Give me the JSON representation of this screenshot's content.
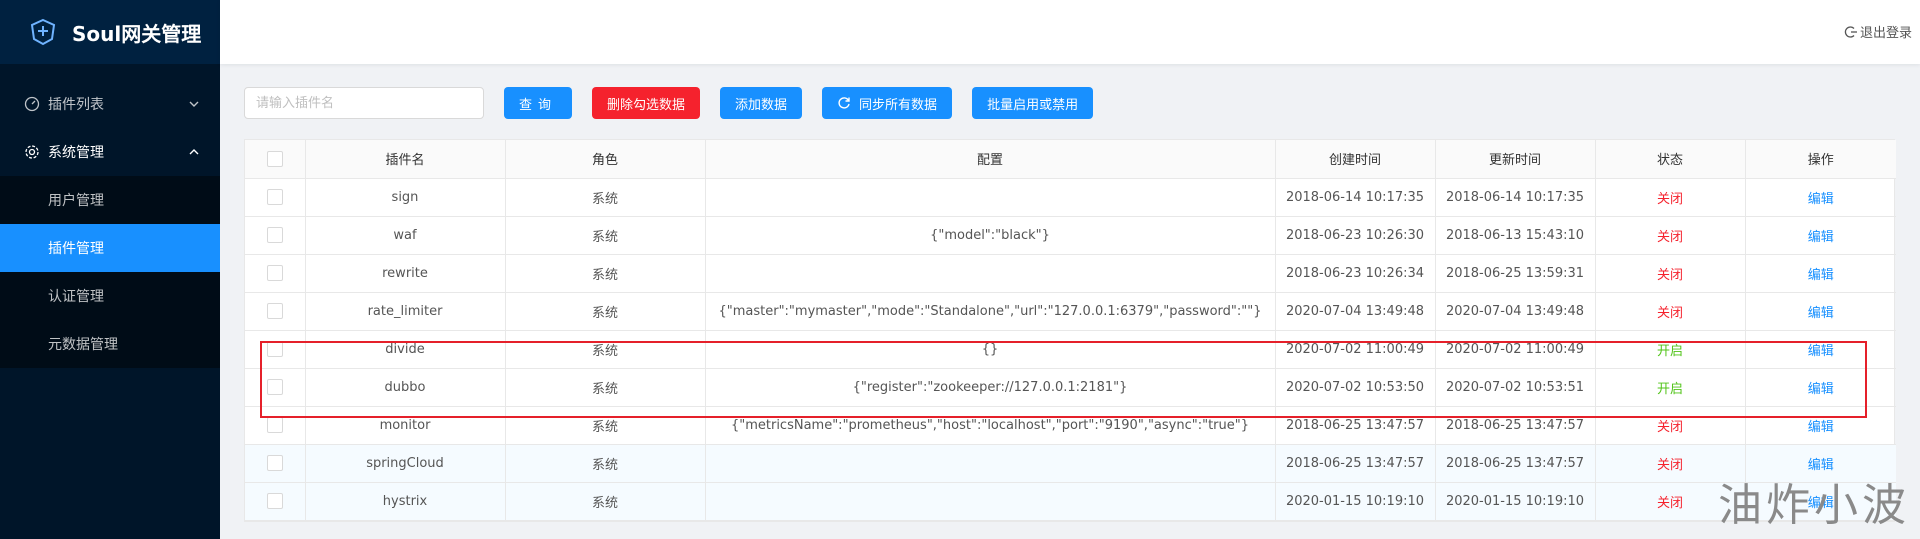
{
  "app": {
    "title": "Soul网关管理"
  },
  "header": {
    "logout_label": "退出登录"
  },
  "sidebar": {
    "items": [
      {
        "label": "插件列表",
        "icon": "dashboard-icon",
        "expanded": false
      },
      {
        "label": "系统管理",
        "icon": "gear-icon",
        "expanded": true,
        "children": [
          "用户管理",
          "插件管理",
          "认证管理",
          "元数据管理"
        ],
        "active_child": "插件管理"
      }
    ]
  },
  "toolbar": {
    "search_placeholder": "请输入插件名",
    "query_label": "查询",
    "delete_label": "删除勾选数据",
    "add_label": "添加数据",
    "sync_label": "同步所有数据",
    "batch_label": "批量启用或禁用"
  },
  "table": {
    "columns": [
      "插件名",
      "角色",
      "配置",
      "创建时间",
      "更新时间",
      "状态",
      "操作"
    ],
    "rows": [
      {
        "name": "sign",
        "role": "系统",
        "config": "",
        "created": "2018-06-14 10:17:35",
        "updated": "2018-06-14 10:17:35",
        "status": "关闭",
        "action": "编辑"
      },
      {
        "name": "waf",
        "role": "系统",
        "config": "{\"model\":\"black\"}",
        "created": "2018-06-23 10:26:30",
        "updated": "2018-06-13 15:43:10",
        "status": "关闭",
        "action": "编辑"
      },
      {
        "name": "rewrite",
        "role": "系统",
        "config": "",
        "created": "2018-06-23 10:26:34",
        "updated": "2018-06-25 13:59:31",
        "status": "关闭",
        "action": "编辑"
      },
      {
        "name": "rate_limiter",
        "role": "系统",
        "config": "{\"master\":\"mymaster\",\"mode\":\"Standalone\",\"url\":\"127.0.0.1:6379\",\"password\":\"\"}",
        "created": "2020-07-04 13:49:48",
        "updated": "2020-07-04 13:49:48",
        "status": "关闭",
        "action": "编辑"
      },
      {
        "name": "divide",
        "role": "系统",
        "config": "{}",
        "created": "2020-07-02 11:00:49",
        "updated": "2020-07-02 11:00:49",
        "status": "开启",
        "action": "编辑"
      },
      {
        "name": "dubbo",
        "role": "系统",
        "config": "{\"register\":\"zookeeper://127.0.0.1:2181\"}",
        "created": "2020-07-02 10:53:50",
        "updated": "2020-07-02 10:53:51",
        "status": "开启",
        "action": "编辑"
      },
      {
        "name": "monitor",
        "role": "系统",
        "config": "{\"metricsName\":\"prometheus\",\"host\":\"localhost\",\"port\":\"9190\",\"async\":\"true\"}",
        "created": "2018-06-25 13:47:57",
        "updated": "2018-06-25 13:47:57",
        "status": "关闭",
        "action": "编辑"
      },
      {
        "name": "springCloud",
        "role": "系统",
        "config": "",
        "created": "2018-06-25 13:47:57",
        "updated": "2018-06-25 13:47:57",
        "status": "关闭",
        "action": "编辑"
      },
      {
        "name": "hystrix",
        "role": "系统",
        "config": "",
        "created": "2020-01-15 10:19:10",
        "updated": "2020-01-15 10:19:10",
        "status": "关闭",
        "action": "编辑"
      }
    ]
  },
  "watermark": "油炸小波",
  "colors": {
    "primary": "#1890ff",
    "danger": "#f5222d",
    "sidebar_bg": "#001529",
    "status_on": "#52c41a",
    "status_off": "#f5222d"
  }
}
